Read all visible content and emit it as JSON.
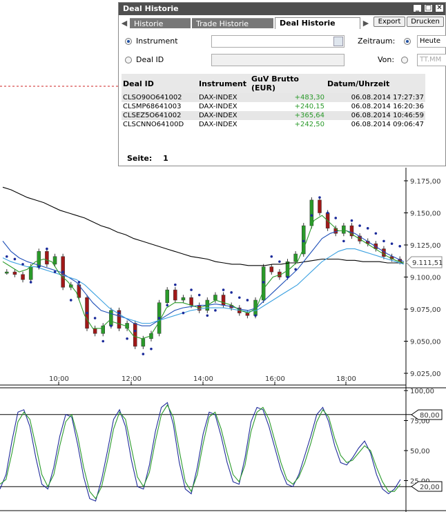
{
  "dialog": {
    "title": "Deal Historie",
    "tabs": [
      "Historie",
      "Trade Historie",
      "Deal Historie"
    ],
    "export_label": "Export",
    "print_label": "Drucken",
    "filter": {
      "instrument_label": "Instrument",
      "deal_id_label": "Deal ID",
      "zeitraum_label": "Zeitraum:",
      "zeitraum_value": "Heute",
      "von_label": "Von:",
      "von_placeholder": "TT.MM"
    },
    "columns": [
      "Deal ID",
      "Instrument",
      "GuV Brutto (EUR)",
      "Datum/Uhrzeit"
    ],
    "rows": [
      {
        "deal_id": "CLSO90O641002",
        "instrument": "DAX-INDEX",
        "guv": "+483,30",
        "datetime": "06.08.2014 17:27:37"
      },
      {
        "deal_id": "CLSMP68641003",
        "instrument": "DAX-INDEX",
        "guv": "+240,15",
        "datetime": "06.08.2014 16:20:36"
      },
      {
        "deal_id": "CLSEZ5O641002",
        "instrument": "DAX-INDEX",
        "guv": "+365,64",
        "datetime": "06.08.2014 10:46:59"
      },
      {
        "deal_id": "CLSCNNO64100D",
        "instrument": "DAX-INDEX",
        "guv": "+242,50",
        "datetime": "06.08.2014 09:06:47"
      }
    ],
    "page_label": "Seite:",
    "page_value": "1"
  },
  "chart_data": [
    {
      "type": "line",
      "title": "",
      "x_ticks": [
        "10:00",
        "12:00",
        "14:00",
        "16:00",
        "18:00"
      ],
      "y_ticks": [
        "9.175,00",
        "9.150,00",
        "9.125,00",
        "9.100,00",
        "9.075,00",
        "9.050,00",
        "9.025,00"
      ],
      "ylim": [
        9025,
        9175
      ],
      "current_price": "9.111,51",
      "series": [
        {
          "values": [
            9104,
            9102,
            9098,
            9108,
            9120,
            9110,
            9116,
            9092,
            9094,
            9084,
            9060,
            9056,
            9062,
            9074,
            9060,
            9064,
            9046,
            9052,
            9056,
            9080,
            9090,
            9082,
            9084,
            9078,
            9074,
            9082,
            9086,
            9078,
            9076,
            9072,
            9070,
            9082,
            9108,
            9104,
            9100,
            9112,
            9118,
            9140,
            9160,
            9150,
            9138,
            9134,
            9140,
            9132,
            9128,
            9126,
            9122,
            9116,
            9114,
            9112
          ]
        },
        {
          "values": [
            9170,
            9168,
            9165,
            9162,
            9160,
            9158,
            9155,
            9152,
            9150,
            9148,
            9146,
            9143,
            9140,
            9138,
            9135,
            9133,
            9130,
            9128,
            9126,
            9124,
            9122,
            9120,
            9118,
            9116,
            9115,
            9114,
            9112,
            9111,
            9110,
            9110,
            9109,
            9109,
            9109,
            9110,
            9110,
            9111,
            9111,
            9112,
            9113,
            9114,
            9114,
            9114,
            9113,
            9113,
            9112,
            9112,
            9112,
            9111,
            9111,
            9111
          ]
        },
        {
          "values": [
            9128,
            9120,
            9115,
            9112,
            9110,
            9108,
            9106,
            9104,
            9100,
            9096,
            9088,
            9080,
            9074,
            9072,
            9070,
            9068,
            9064,
            9062,
            9062,
            9066,
            9070,
            9074,
            9076,
            9077,
            9078,
            9078,
            9079,
            9078,
            9077,
            9075,
            9074,
            9076,
            9082,
            9088,
            9094,
            9100,
            9106,
            9114,
            9122,
            9130,
            9134,
            9136,
            9136,
            9134,
            9130,
            9126,
            9122,
            9118,
            9115,
            9112
          ]
        },
        {
          "values": [
            9115,
            9112,
            9110,
            9108,
            9108,
            9106,
            9104,
            9102,
            9100,
            9098,
            9094,
            9088,
            9082,
            9076,
            9072,
            9068,
            9066,
            9064,
            9064,
            9066,
            9068,
            9070,
            9072,
            9074,
            9075,
            9076,
            9076,
            9076,
            9075,
            9074,
            9073,
            9074,
            9078,
            9082,
            9086,
            9090,
            9094,
            9100,
            9106,
            9112,
            9116,
            9120,
            9122,
            9122,
            9120,
            9118,
            9116,
            9114,
            9112,
            9110
          ]
        },
        {
          "values": [
            9112,
            9108,
            9104,
            9106,
            9112,
            9114,
            9112,
            9102,
            9096,
            9088,
            9070,
            9060,
            9060,
            9066,
            9064,
            9062,
            9054,
            9052,
            9054,
            9064,
            9076,
            9080,
            9080,
            9078,
            9076,
            9078,
            9082,
            9080,
            9078,
            9074,
            9072,
            9076,
            9092,
            9100,
            9102,
            9106,
            9112,
            9126,
            9144,
            9148,
            9142,
            9136,
            9136,
            9132,
            9128,
            9124,
            9120,
            9116,
            9113,
            9111
          ]
        }
      ]
    },
    {
      "type": "line",
      "title": "",
      "y_ticks": [
        "100,00",
        "75,00",
        "50,00",
        "25,00"
      ],
      "ylim": [
        0,
        100
      ],
      "levels": [
        "80,00",
        "20,00"
      ],
      "series": [
        {
          "values": [
            18,
            30,
            58,
            82,
            84,
            70,
            44,
            22,
            18,
            36,
            62,
            80,
            78,
            55,
            28,
            10,
            8,
            26,
            50,
            76,
            84,
            70,
            42,
            20,
            18,
            38,
            66,
            86,
            90,
            72,
            40,
            18,
            14,
            36,
            64,
            82,
            80,
            62,
            40,
            24,
            22,
            44,
            74,
            86,
            84,
            70,
            52,
            34,
            22,
            20,
            30,
            46,
            62,
            80,
            86,
            74,
            54,
            40,
            38,
            44,
            52,
            58,
            48,
            30,
            18,
            14,
            18,
            26
          ]
        },
        {
          "values": [
            22,
            26,
            48,
            74,
            82,
            76,
            54,
            30,
            20,
            30,
            54,
            74,
            80,
            62,
            36,
            16,
            10,
            20,
            42,
            68,
            82,
            76,
            52,
            28,
            20,
            32,
            58,
            80,
            88,
            78,
            50,
            24,
            16,
            30,
            56,
            78,
            82,
            68,
            48,
            30,
            24,
            38,
            66,
            82,
            86,
            76,
            58,
            40,
            26,
            22,
            28,
            40,
            56,
            74,
            84,
            78,
            60,
            46,
            40,
            42,
            48,
            54,
            50,
            36,
            24,
            16,
            16,
            22
          ]
        }
      ]
    }
  ]
}
